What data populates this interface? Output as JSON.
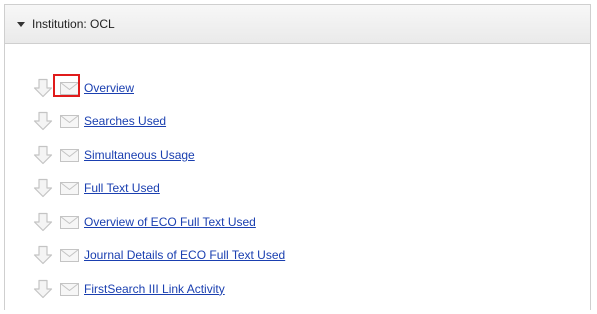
{
  "panel": {
    "title": "Institution: OCL",
    "collapse_icon": "triangle-down-icon"
  },
  "reports": [
    {
      "label": "Overview",
      "download_icon": "download-arrow-icon",
      "email_icon": "email-envelope-icon",
      "highlighted": true
    },
    {
      "label": "Searches Used",
      "download_icon": "download-arrow-icon",
      "email_icon": "email-envelope-icon",
      "highlighted": false
    },
    {
      "label": "Simultaneous Usage",
      "download_icon": "download-arrow-icon",
      "email_icon": "email-envelope-icon",
      "highlighted": false
    },
    {
      "label": "Full Text Used",
      "download_icon": "download-arrow-icon",
      "email_icon": "email-envelope-icon",
      "highlighted": false
    },
    {
      "label": "Overview of ECO Full Text Used",
      "download_icon": "download-arrow-icon",
      "email_icon": "email-envelope-icon",
      "highlighted": false
    },
    {
      "label": "Journal Details of ECO Full Text Used",
      "download_icon": "download-arrow-icon",
      "email_icon": "email-envelope-icon",
      "highlighted": false
    },
    {
      "label": "FirstSearch III Link Activity",
      "download_icon": "download-arrow-icon",
      "email_icon": "email-envelope-icon",
      "highlighted": false
    }
  ],
  "colors": {
    "link": "#1a3fb0",
    "highlight_box": "#e01b1b",
    "icon_gray": "#c4c4c4"
  }
}
